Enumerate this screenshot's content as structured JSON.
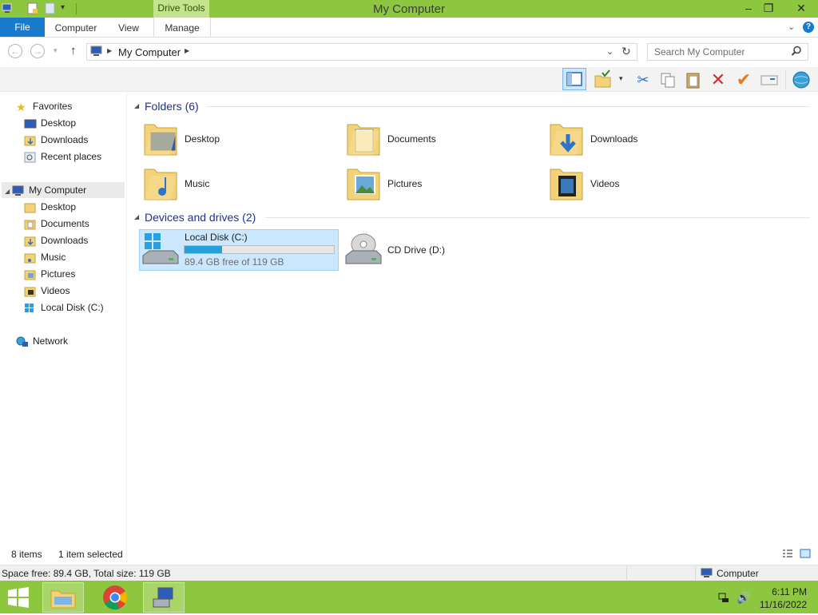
{
  "window": {
    "title": "My Computer",
    "context_tab_label": "Drive Tools",
    "controls": {
      "minimize": "–",
      "maximize": "❐",
      "close": "✕"
    }
  },
  "ribbon": {
    "file_tab": "File",
    "tabs": [
      "Computer",
      "View",
      "Manage"
    ]
  },
  "address": {
    "path": "My Computer",
    "search_placeholder": "Search My Computer"
  },
  "nav_pane": {
    "favorites_label": "Favorites",
    "favorites": [
      "Desktop",
      "Downloads",
      "Recent places"
    ],
    "computer_label": "My Computer",
    "computer_items": [
      "Desktop",
      "Documents",
      "Downloads",
      "Music",
      "Pictures",
      "Videos",
      "Local Disk (C:)"
    ],
    "network_label": "Network"
  },
  "content": {
    "folders_header": "Folders (6)",
    "folders": [
      "Desktop",
      "Documents",
      "Downloads",
      "Music",
      "Pictures",
      "Videos"
    ],
    "devices_header": "Devices and drives (2)",
    "local_disk": {
      "name": "Local Disk (C:)",
      "free_text": "89.4 GB free of 119 GB",
      "used_fraction": 0.249
    },
    "cd_drive": {
      "name": "CD Drive (D:)"
    }
  },
  "status": {
    "items": "8 items",
    "selected": "1 item selected",
    "space": "Space free: 89.4 GB, Total size: 119 GB",
    "location": "Computer"
  },
  "taskbar": {
    "time": "6:11 PM",
    "date": "11/16/2022"
  },
  "colors": {
    "accent_green": "#8dc63f",
    "file_tab_blue": "#1979ca",
    "selection": "#cce8ff",
    "progress": "#26a0da",
    "section_header": "#1e3287"
  }
}
